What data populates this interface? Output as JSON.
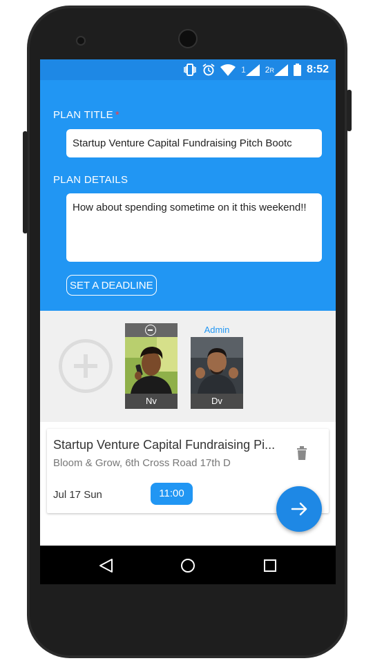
{
  "status": {
    "sim1": "1",
    "sim2": "2",
    "sim2_roaming": "R",
    "time": "8:52"
  },
  "form": {
    "title_label": "PLAN TITLE",
    "required_mark": "*",
    "title_value": "Startup Venture Capital Fundraising Pitch Bootc",
    "details_label": "PLAN DETAILS",
    "details_value": "How about spending sometime on it this weekend!!",
    "deadline_button": "SET A DEADLINE"
  },
  "members": [
    {
      "name": "Nv",
      "role": ""
    },
    {
      "name": "Dv",
      "role": "Admin"
    }
  ],
  "plan_card": {
    "title": "Startup Venture Capital Fundraising Pi...",
    "location": "Bloom & Grow, 6th Cross Road 17th D",
    "date": "Jul 17 Sun",
    "time": "11:00"
  },
  "colors": {
    "accent": "#2196f3",
    "status_bar": "#1e88e5",
    "fab": "#1e88e5"
  },
  "icons": [
    "vibrate-icon",
    "alarm-icon",
    "wifi-icon",
    "signal-icon",
    "battery-icon",
    "remove-member-icon",
    "add-member-icon",
    "delete-icon",
    "arrow-right-icon",
    "back-icon",
    "home-icon",
    "recents-icon"
  ]
}
